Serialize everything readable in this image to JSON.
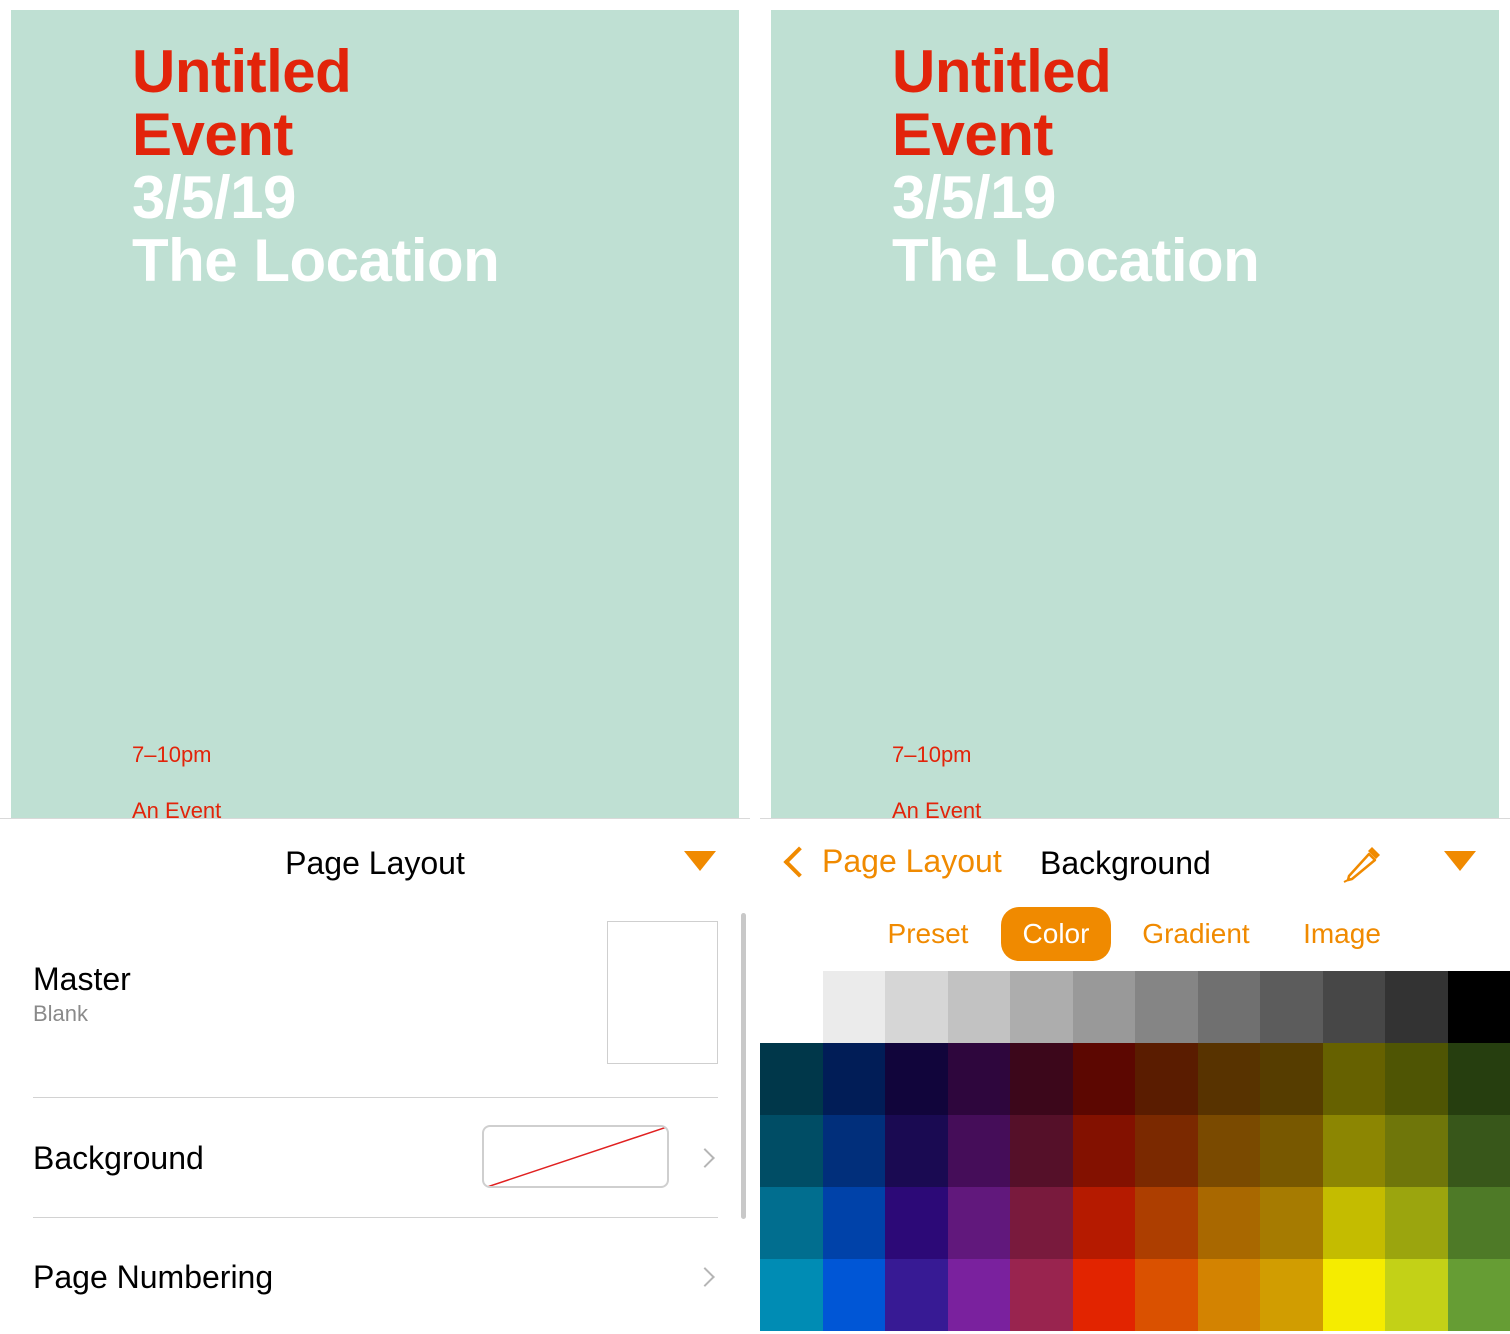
{
  "document": {
    "title_line1": "Untitled",
    "title_line2": "Event",
    "date": "3/5/19",
    "location": "The Location",
    "time": "7–10pm",
    "event_label": "An Event"
  },
  "left_panel": {
    "title": "Page Layout",
    "collapse_icon": "triangle-down-icon",
    "master_label": "Master",
    "master_value": "Blank",
    "background_label": "Background",
    "page_numbering_label": "Page Numbering"
  },
  "right_panel": {
    "back_label": "Page Layout",
    "title": "Background",
    "eyedropper_icon": "eyedropper-icon",
    "tabs": [
      "Preset",
      "Color",
      "Gradient",
      "Image"
    ],
    "active_tab": "Color"
  },
  "colors": {
    "accent": "#f08a00",
    "page_bg": "#bfe0d3",
    "title_red": "#e2240a",
    "swatch_rows": [
      [
        "#ffffff",
        "#ebebeb",
        "#d6d6d6",
        "#c2c2c2",
        "#adadad",
        "#999999",
        "#858585",
        "#707070",
        "#5c5c5c",
        "#474747",
        "#333333",
        "#000000"
      ],
      [
        "#00374a",
        "#011d57",
        "#11053b",
        "#2e063d",
        "#3c071b",
        "#5c0701",
        "#5a1c00",
        "#583300",
        "#563d00",
        "#666100",
        "#4f5504",
        "#263e0f"
      ],
      [
        "#004d65",
        "#012f7b",
        "#1a0a52",
        "#450d59",
        "#551029",
        "#831100",
        "#7b2900",
        "#7a4a00",
        "#785800",
        "#8c8602",
        "#6f760a",
        "#38571a"
      ],
      [
        "#016e8f",
        "#0042a9",
        "#2c0977",
        "#61187c",
        "#791a3d",
        "#b51a00",
        "#ad3e00",
        "#a96800",
        "#a67b01",
        "#c4bc00",
        "#9ba50e",
        "#4e7a27"
      ],
      [
        "#008cb4",
        "#0056d6",
        "#371a94",
        "#7a219e",
        "#99244f",
        "#e22400",
        "#da5100",
        "#d38301",
        "#d19d01",
        "#f5ec00",
        "#c3d117",
        "#669d34"
      ]
    ]
  }
}
